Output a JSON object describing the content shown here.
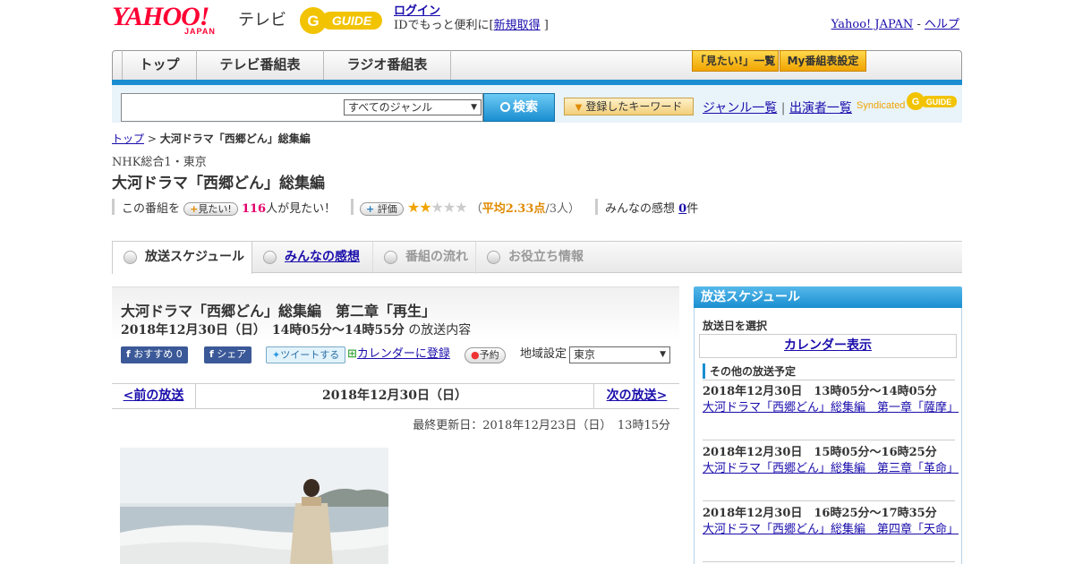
{
  "header": {
    "logo_yahoo": "YAHOO!",
    "logo_japan": "JAPAN",
    "logo_tv": "テレビ",
    "guide_logo": "G GUIDE",
    "login": "ログイン",
    "login_sub_prefix": "IDでもっと便利に[",
    "signup": "新規取得",
    "login_sub_suffix": "]",
    "yahoo_japan_link": "Yahoo! JAPAN",
    "sep": "-",
    "help_link": "ヘルプ"
  },
  "nav": {
    "tabs": [
      "トップ",
      "テレビ番組表",
      "ラジオ番組表"
    ],
    "mitai_list": "「見たい!」一覧",
    "my_schedule": "My番組表設定"
  },
  "search": {
    "genre": "すべてのジャンル",
    "button": "検索",
    "keyword_button": "登録したキーワード",
    "genre_list": "ジャンル一覧",
    "divider": "|",
    "cast_list": "出演者一覧",
    "syndicated": "Syndicated"
  },
  "breadcrumb": {
    "top": "トップ",
    "sep": ">",
    "current": "大河ドラマ「西郷どん」総集編"
  },
  "program": {
    "channel": "NHK総合1・東京",
    "title": "大河ドラマ「西郷どん」総集編",
    "mitai_prefix": "この番組を",
    "mitai_button": "見たい!",
    "mitai_count": "116",
    "mitai_suffix": "人が見たい！",
    "rate_button": "評価",
    "rating_stars": 2.33,
    "rating_open": "（",
    "rating_avg": "平均2.33点",
    "rating_people": "/3人）",
    "impressions_label": "みんなの感想",
    "impressions_count": "0",
    "impressions_suffix": "件"
  },
  "tabs": [
    {
      "label": "放送スケジュール"
    },
    {
      "label": "みんなの感想"
    },
    {
      "label": "番組の流れ"
    },
    {
      "label": "お役立ち情報"
    }
  ],
  "episode": {
    "title": "大河ドラマ「西郷どん」総集編　第二章「再生」",
    "datetime": "2018年12月30日（日）　14時05分～14時55分",
    "datetime_suffix": "の放送内容",
    "share_fb_recommend": "おすすめ",
    "share_fb_count": "0",
    "share_fb_share": "シェア",
    "tweet": "ツイートする",
    "calendar_register": "カレンダーに登録",
    "reserve": "予約",
    "region_label": "地域設定",
    "region_value": "東京"
  },
  "daynav": {
    "prev": "<前の放送",
    "date": "2018年12月30日（日）",
    "next": "次の放送>"
  },
  "updated": "最終更新日：2018年12月23日（日）　13時15分",
  "sidebar": {
    "title": "放送スケジュール",
    "select_date": "放送日を選択",
    "calendar": "カレンダー表示",
    "other": "その他の放送予定",
    "items": [
      {
        "time": "2018年12月30日　13時05分～14時05分",
        "title": "大河ドラマ「西郷どん」総集編　第一章「薩摩」"
      },
      {
        "time": "2018年12月30日　15時05分～16時25分",
        "title": "大河ドラマ「西郷どん」総集編　第三章「革命」"
      },
      {
        "time": "2018年12月30日　16時25分～17時35分",
        "title": "大河ドラマ「西郷どん」総集編　第四章「天命」"
      }
    ]
  },
  "colors": {
    "accent_blue": "#1a8ed0",
    "yahoo_red": "#ff0033",
    "guide_yellow": "#f0a400",
    "count_red": "#e4006a"
  }
}
